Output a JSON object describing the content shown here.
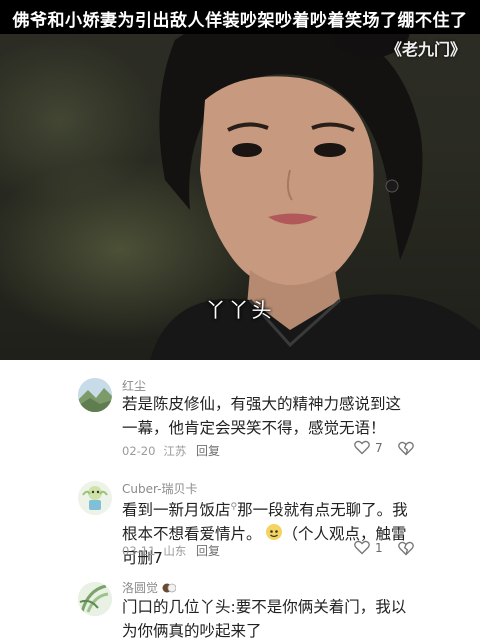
{
  "video": {
    "caption": "佛爷和小娇妻为引出敌人佯装吵架吵着吵着笑场了绷不住了",
    "watermark": "《老九门》",
    "subtitle": "丫丫头"
  },
  "comments": [
    {
      "username": "红尘",
      "text": "若是陈皮修仙，有强大的精神力感说到这一幕，他肯定会哭笑不得，感觉无语！",
      "date": "02-20",
      "location": "江苏",
      "reply_label": "回复",
      "likes": "7"
    },
    {
      "username": "Cuber-瑞贝卡",
      "text_part1": "看到一新月饭店",
      "text_part2": "那一段就有点无聊了。我根本不想看爱情片。",
      "text_part3": "（个人观点，触雷可删7",
      "date": "03-11",
      "location": "山东",
      "reply_label": "回复",
      "likes": "1"
    },
    {
      "username": "洛圆觉",
      "text": "门口的几位丫头:要不是你俩关着门，我以为你俩真的吵起来了"
    }
  ],
  "colors": {
    "accent_text": "#222222",
    "meta_text": "#9a9a9a",
    "video_bg": "#2a2b22"
  }
}
